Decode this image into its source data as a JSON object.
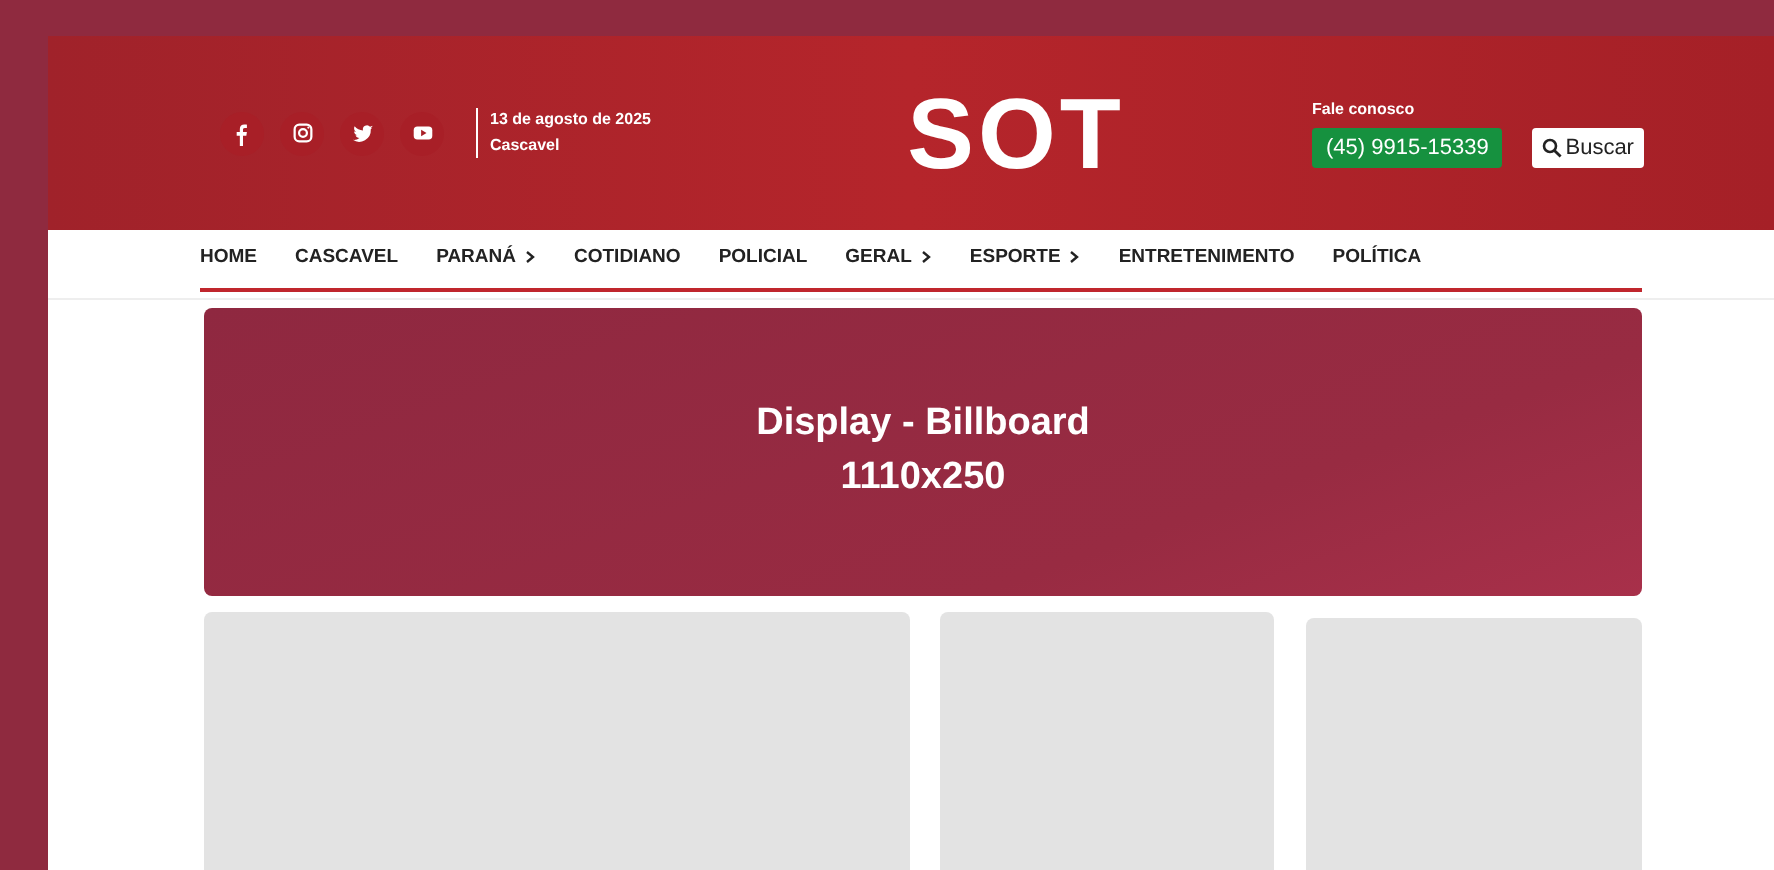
{
  "header": {
    "social": [
      {
        "kind": "facebook"
      },
      {
        "kind": "instagram"
      },
      {
        "kind": "twitter"
      },
      {
        "kind": "youtube"
      }
    ],
    "date": "13 de agosto de 2025",
    "city": "Cascavel",
    "logo": "SOT",
    "contact_label": "Fale conosco",
    "phone": "(45) 9915-15339",
    "search_button": "Buscar"
  },
  "nav": [
    {
      "label": "HOME",
      "submenu": false
    },
    {
      "label": "CASCAVEL",
      "submenu": false
    },
    {
      "label": "PARANÁ",
      "submenu": true
    },
    {
      "label": "COTIDIANO",
      "submenu": false
    },
    {
      "label": "POLICIAL",
      "submenu": false
    },
    {
      "label": "GERAL",
      "submenu": true
    },
    {
      "label": "ESPORTE",
      "submenu": true
    },
    {
      "label": "ENTRETENIMENTO",
      "submenu": false
    },
    {
      "label": "POLÍTICA",
      "submenu": false
    }
  ],
  "billboard": {
    "title": "Display - Billboard",
    "size": "1110x250"
  }
}
